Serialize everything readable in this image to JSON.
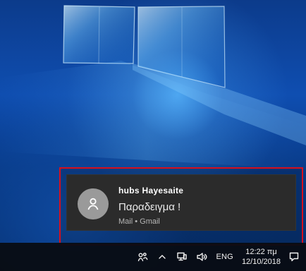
{
  "notification": {
    "sender": "hubs Hayesaite",
    "message": "Παραδειγμα !",
    "source": "Mail • Gmail",
    "avatar_icon": "person-icon"
  },
  "taskbar": {
    "tray": {
      "people_icon": "people-icon",
      "hidden_icons_icon": "chevron-up-icon",
      "network_icon": "network-icon",
      "volume_icon": "volume-icon",
      "language": "ENG",
      "time": "12:22 πμ",
      "date": "12/10/2018",
      "action_center_icon": "action-center-icon"
    }
  },
  "colors": {
    "highlight_border": "#d80f1c",
    "toast_background": "#2b2b2b",
    "taskbar_background": "#080c12"
  }
}
